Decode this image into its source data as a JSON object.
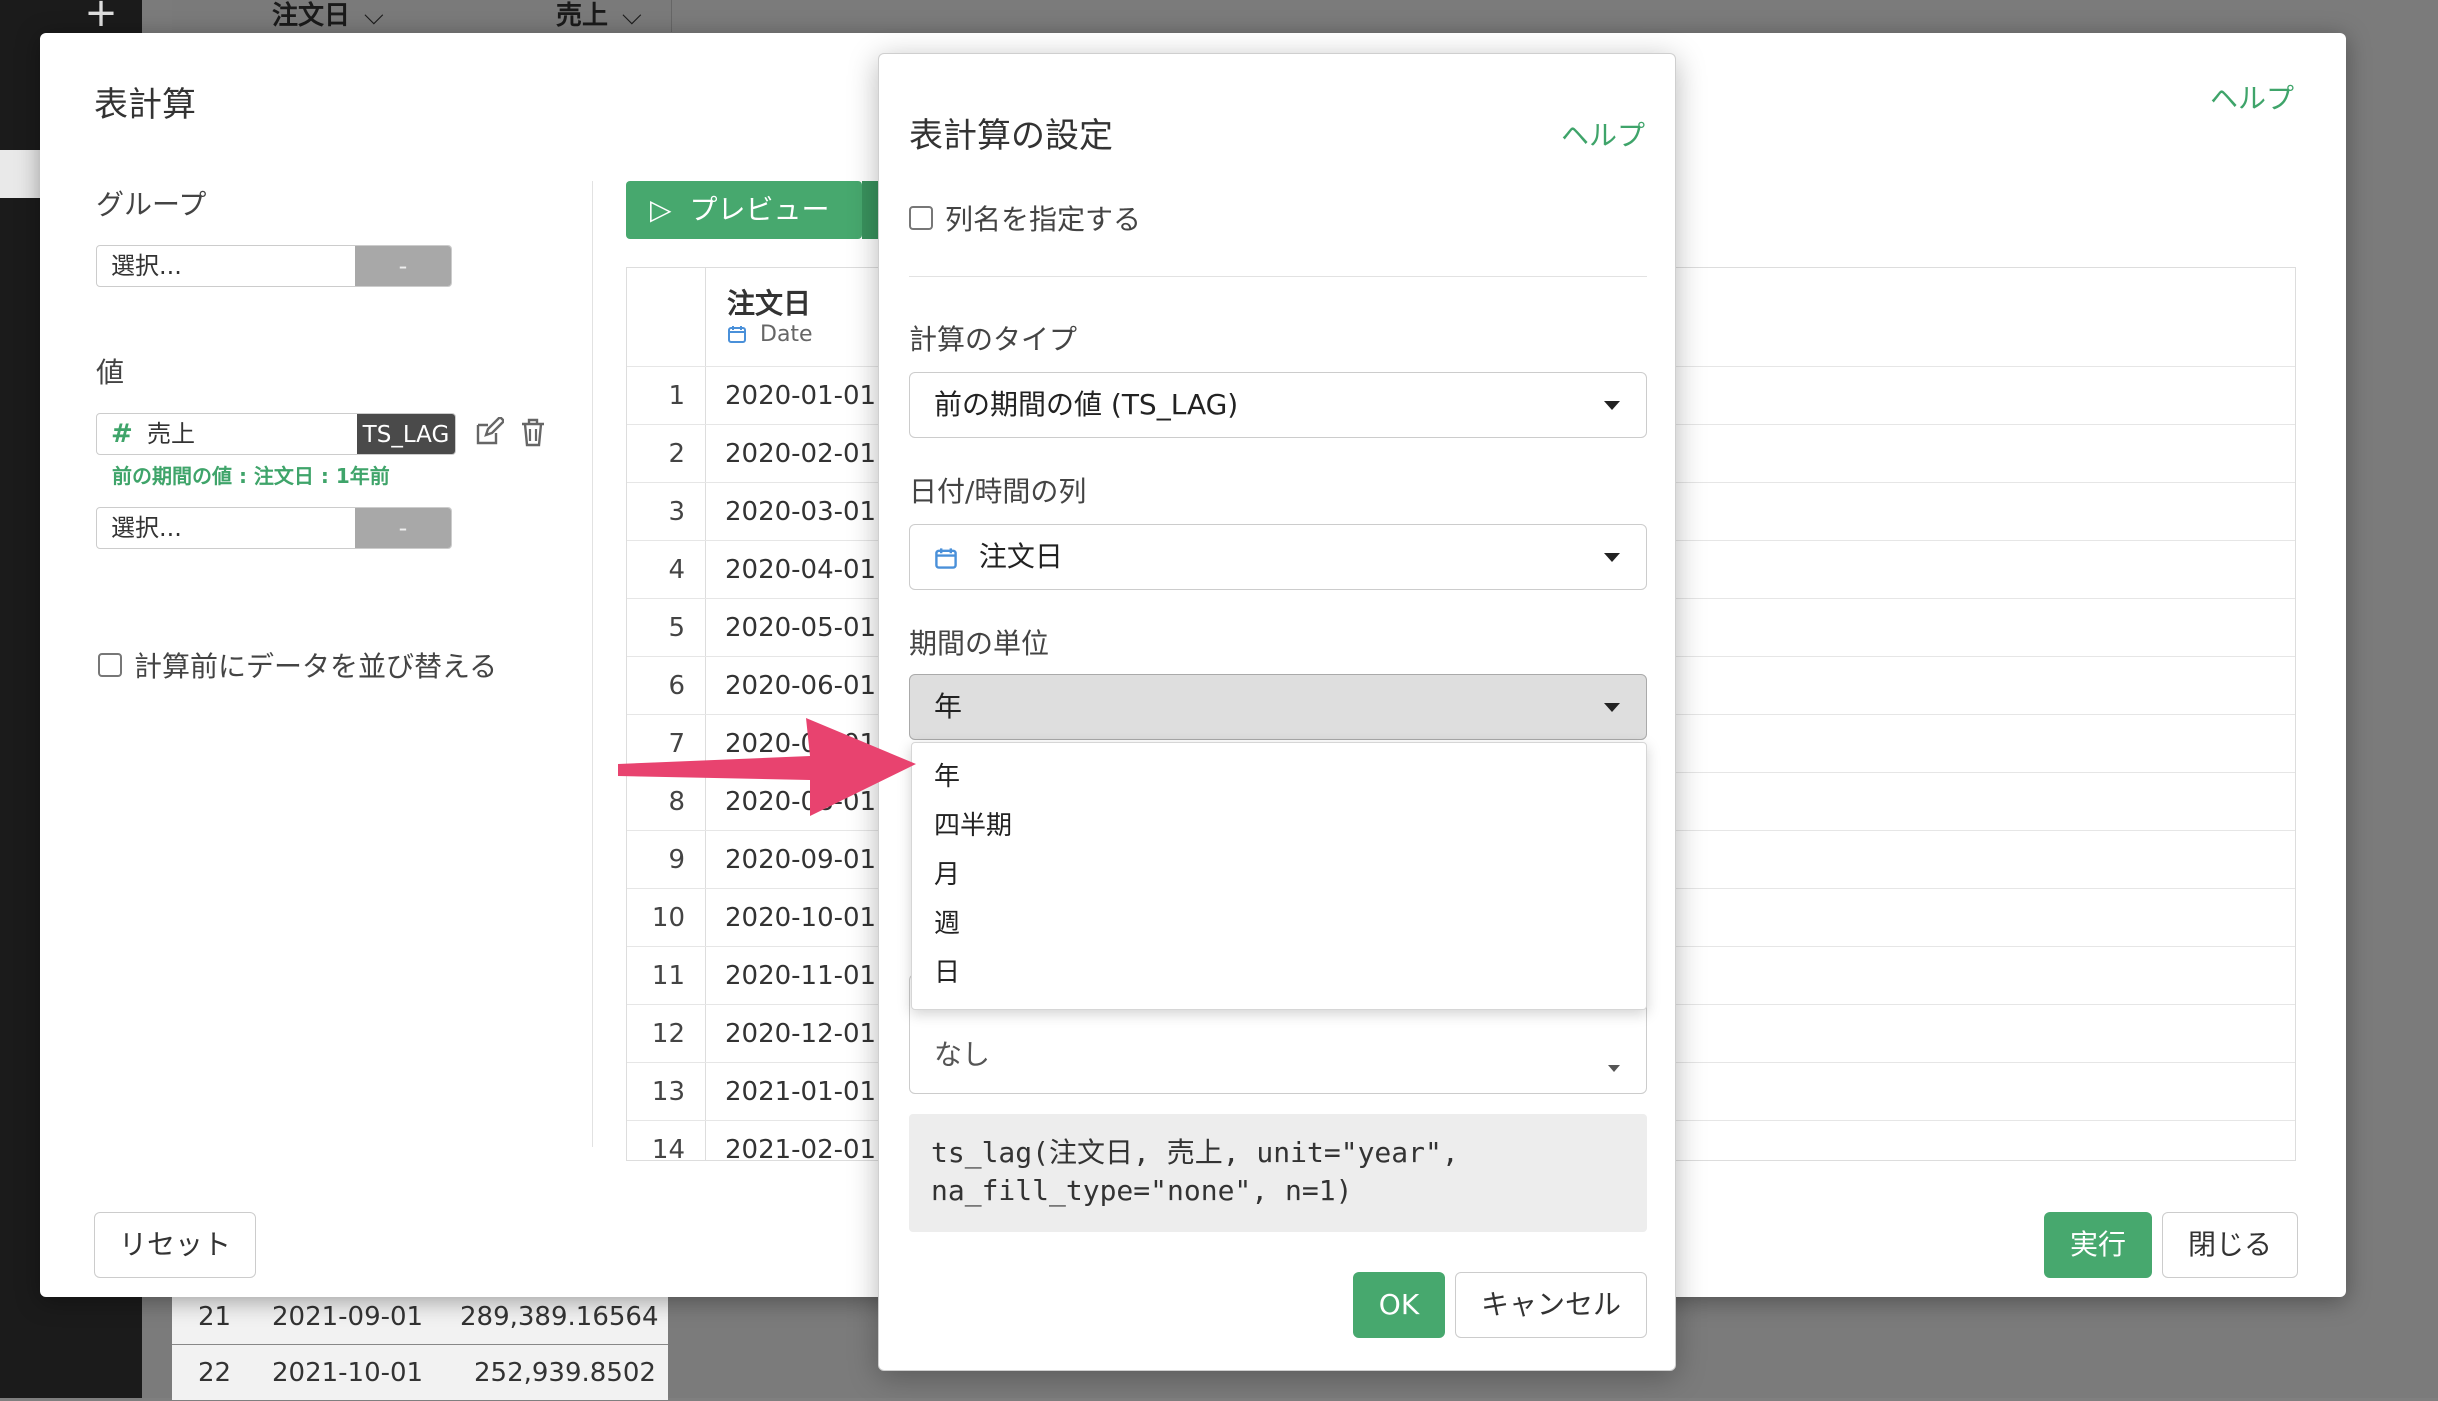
{
  "background": {
    "plus": "+",
    "columns": [
      {
        "label": "注文日",
        "chevron": "⌵"
      },
      {
        "label": "売上",
        "chevron": "⌵"
      }
    ],
    "rows": [
      {
        "num": "21",
        "date": "2021-09-01",
        "value": "289,389.16564"
      },
      {
        "num": "22",
        "date": "2021-10-01",
        "value": "252,939.8502"
      }
    ]
  },
  "main_dialog": {
    "title": "表計算",
    "help": "ヘルプ",
    "group_label": "グループ",
    "group_select_placeholder": "選択...",
    "group_select_button": "-",
    "value_label": "値",
    "value_item": {
      "hash": "#",
      "name": "売上",
      "tag": "TS_LAG"
    },
    "value_description": "前の期間の値 : 注文日 : 1年前",
    "value_select_placeholder": "選択...",
    "value_select_button": "-",
    "sort_checkbox_label": "計算前にデータを並び替える",
    "preview_button": "プレビュー",
    "preview_icon": "▷",
    "table": {
      "column_name": "注文日",
      "column_type": "Date",
      "rows": [
        {
          "num": "1",
          "value": "2020-01-01"
        },
        {
          "num": "2",
          "value": "2020-02-01"
        },
        {
          "num": "3",
          "value": "2020-03-01"
        },
        {
          "num": "4",
          "value": "2020-04-01"
        },
        {
          "num": "5",
          "value": "2020-05-01"
        },
        {
          "num": "6",
          "value": "2020-06-01"
        },
        {
          "num": "7",
          "value": "2020-07-01"
        },
        {
          "num": "8",
          "value": "2020-08-01"
        },
        {
          "num": "9",
          "value": "2020-09-01"
        },
        {
          "num": "10",
          "value": "2020-10-01"
        },
        {
          "num": "11",
          "value": "2020-11-01"
        },
        {
          "num": "12",
          "value": "2020-12-01"
        },
        {
          "num": "13",
          "value": "2021-01-01"
        },
        {
          "num": "14",
          "value": "2021-02-01"
        }
      ]
    },
    "reset_button": "リセット",
    "run_button": "実行",
    "close_button": "閉じる"
  },
  "settings_dialog": {
    "title": "表計算の設定",
    "help": "ヘルプ",
    "column_name_checkbox": "列名を指定する",
    "calc_type_label": "計算のタイプ",
    "calc_type_value": "前の期間の値 (TS_LAG)",
    "date_column_label": "日付/時間の列",
    "date_column_value": "注文日",
    "period_unit_label": "期間の単位",
    "period_unit_value": "年",
    "period_unit_options": [
      "年",
      "四半期",
      "月",
      "週",
      "日"
    ],
    "hidden_dropdown_value": "なし",
    "code": "ts_lag(注文日, 売上, unit=\"year\",\nna_fill_type=\"none\", n=1)",
    "ok_button": "OK",
    "cancel_button": "キャンセル"
  },
  "colors": {
    "accent_green": "#47a86e",
    "link_green": "#3fa46a",
    "arrow_pink": "#e8436f",
    "calendar_blue": "#4a90d9"
  }
}
